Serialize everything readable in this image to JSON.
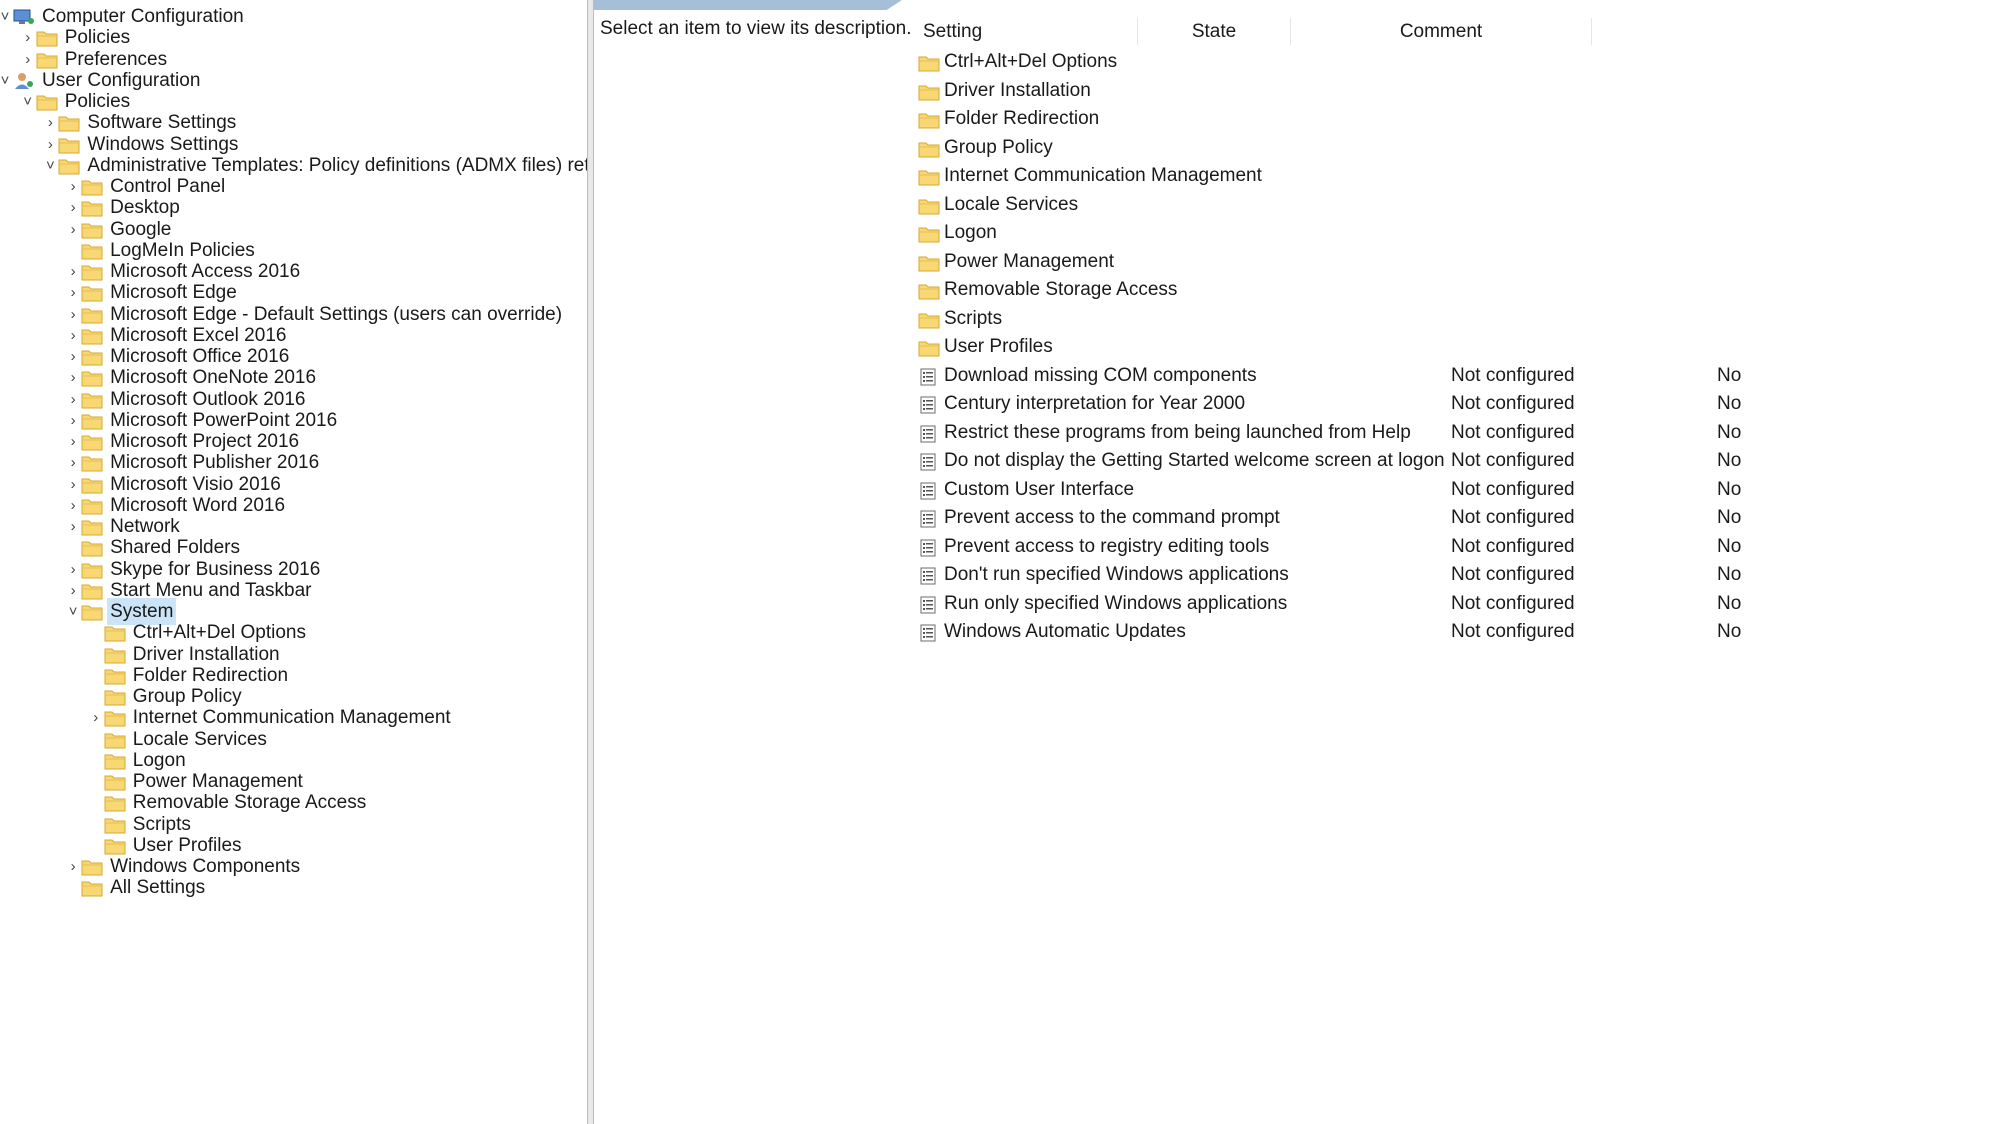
{
  "tree": [
    {
      "label": "Computer Configuration",
      "chev": "down",
      "icon": "computer-config-icon",
      "level": 0
    },
    {
      "label": "Policies",
      "chev": "right",
      "icon": "folder-icon",
      "level": 1
    },
    {
      "label": "Preferences",
      "chev": "right",
      "icon": "folder-icon",
      "level": 1
    },
    {
      "label": "User Configuration",
      "chev": "down",
      "icon": "user-config-icon",
      "level": 0
    },
    {
      "label": "Policies",
      "chev": "down",
      "icon": "folder-icon",
      "level": 1
    },
    {
      "label": "Software Settings",
      "chev": "right",
      "icon": "folder-icon",
      "level": 2
    },
    {
      "label": "Windows Settings",
      "chev": "right",
      "icon": "folder-icon",
      "level": 2
    },
    {
      "label": "Administrative Templates: Policy definitions (ADMX files) retrieved from the central store.",
      "chev": "down",
      "icon": "folder-icon",
      "level": 2
    },
    {
      "label": "Control Panel",
      "chev": "right",
      "icon": "folder-icon",
      "level": 3
    },
    {
      "label": "Desktop",
      "chev": "right",
      "icon": "folder-icon",
      "level": 3
    },
    {
      "label": "Google",
      "chev": "right",
      "icon": "folder-icon",
      "level": 3
    },
    {
      "label": "LogMeIn Policies",
      "chev": "none",
      "icon": "folder-icon",
      "level": 3
    },
    {
      "label": "Microsoft Access 2016",
      "chev": "right",
      "icon": "folder-icon",
      "level": 3
    },
    {
      "label": "Microsoft Edge",
      "chev": "right",
      "icon": "folder-icon",
      "level": 3
    },
    {
      "label": "Microsoft Edge - Default Settings (users can override)",
      "chev": "right",
      "icon": "folder-icon",
      "level": 3
    },
    {
      "label": "Microsoft Excel 2016",
      "chev": "right",
      "icon": "folder-icon",
      "level": 3
    },
    {
      "label": "Microsoft Office 2016",
      "chev": "right",
      "icon": "folder-icon",
      "level": 3
    },
    {
      "label": "Microsoft OneNote 2016",
      "chev": "right",
      "icon": "folder-icon",
      "level": 3
    },
    {
      "label": "Microsoft Outlook 2016",
      "chev": "right",
      "icon": "folder-icon",
      "level": 3
    },
    {
      "label": "Microsoft PowerPoint 2016",
      "chev": "right",
      "icon": "folder-icon",
      "level": 3
    },
    {
      "label": "Microsoft Project 2016",
      "chev": "right",
      "icon": "folder-icon",
      "level": 3
    },
    {
      "label": "Microsoft Publisher 2016",
      "chev": "right",
      "icon": "folder-icon",
      "level": 3
    },
    {
      "label": "Microsoft Visio 2016",
      "chev": "right",
      "icon": "folder-icon",
      "level": 3
    },
    {
      "label": "Microsoft Word 2016",
      "chev": "right",
      "icon": "folder-icon",
      "level": 3
    },
    {
      "label": "Network",
      "chev": "right",
      "icon": "folder-icon",
      "level": 3
    },
    {
      "label": "Shared Folders",
      "chev": "none",
      "icon": "folder-icon",
      "level": 3
    },
    {
      "label": "Skype for Business 2016",
      "chev": "right",
      "icon": "folder-icon",
      "level": 3
    },
    {
      "label": "Start Menu and Taskbar",
      "chev": "right",
      "icon": "folder-icon",
      "level": 3
    },
    {
      "label": "System",
      "chev": "down",
      "icon": "folder-icon",
      "level": 3,
      "selected": true
    },
    {
      "label": "Ctrl+Alt+Del Options",
      "chev": "none",
      "icon": "folder-icon",
      "level": 4
    },
    {
      "label": "Driver Installation",
      "chev": "none",
      "icon": "folder-icon",
      "level": 4
    },
    {
      "label": "Folder Redirection",
      "chev": "none",
      "icon": "folder-icon",
      "level": 4
    },
    {
      "label": "Group Policy",
      "chev": "none",
      "icon": "folder-icon",
      "level": 4
    },
    {
      "label": "Internet Communication Management",
      "chev": "right",
      "icon": "folder-icon",
      "level": 4
    },
    {
      "label": "Locale Services",
      "chev": "none",
      "icon": "folder-icon",
      "level": 4
    },
    {
      "label": "Logon",
      "chev": "none",
      "icon": "folder-icon",
      "level": 4
    },
    {
      "label": "Power Management",
      "chev": "none",
      "icon": "folder-icon",
      "level": 4
    },
    {
      "label": "Removable Storage Access",
      "chev": "none",
      "icon": "folder-icon",
      "level": 4
    },
    {
      "label": "Scripts",
      "chev": "none",
      "icon": "folder-icon",
      "level": 4
    },
    {
      "label": "User Profiles",
      "chev": "none",
      "icon": "folder-icon",
      "level": 4
    },
    {
      "label": "Windows Components",
      "chev": "right",
      "icon": "folder-icon",
      "level": 3
    },
    {
      "label": "All Settings",
      "chev": "none",
      "icon": "folder-icon",
      "level": 3
    }
  ],
  "description": "Select an item to view its description.",
  "columns": {
    "setting": "Setting",
    "state": "State",
    "comment": "Comment"
  },
  "settings": [
    {
      "name": "Ctrl+Alt+Del Options",
      "type": "folder",
      "state": "",
      "comment": ""
    },
    {
      "name": "Driver Installation",
      "type": "folder",
      "state": "",
      "comment": ""
    },
    {
      "name": "Folder Redirection",
      "type": "folder",
      "state": "",
      "comment": ""
    },
    {
      "name": "Group Policy",
      "type": "folder",
      "state": "",
      "comment": ""
    },
    {
      "name": "Internet Communication Management",
      "type": "folder",
      "state": "",
      "comment": ""
    },
    {
      "name": "Locale Services",
      "type": "folder",
      "state": "",
      "comment": ""
    },
    {
      "name": "Logon",
      "type": "folder",
      "state": "",
      "comment": ""
    },
    {
      "name": "Power Management",
      "type": "folder",
      "state": "",
      "comment": ""
    },
    {
      "name": "Removable Storage Access",
      "type": "folder",
      "state": "",
      "comment": ""
    },
    {
      "name": "Scripts",
      "type": "folder",
      "state": "",
      "comment": ""
    },
    {
      "name": "User Profiles",
      "type": "folder",
      "state": "",
      "comment": ""
    },
    {
      "name": "Download missing COM components",
      "type": "policy",
      "state": "Not configured",
      "comment": "No"
    },
    {
      "name": "Century interpretation for Year 2000",
      "type": "policy",
      "state": "Not configured",
      "comment": "No"
    },
    {
      "name": "Restrict these programs from being launched from Help",
      "type": "policy",
      "state": "Not configured",
      "comment": "No"
    },
    {
      "name": "Do not display the Getting Started welcome screen at logon",
      "type": "policy",
      "state": "Not configured",
      "comment": "No"
    },
    {
      "name": "Custom User Interface",
      "type": "policy",
      "state": "Not configured",
      "comment": "No"
    },
    {
      "name": "Prevent access to the command prompt",
      "type": "policy",
      "state": "Not configured",
      "comment": "No"
    },
    {
      "name": "Prevent access to registry editing tools",
      "type": "policy",
      "state": "Not configured",
      "comment": "No"
    },
    {
      "name": "Don't run specified Windows applications",
      "type": "policy",
      "state": "Not configured",
      "comment": "No"
    },
    {
      "name": "Run only specified Windows applications",
      "type": "policy",
      "state": "Not configured",
      "comment": "No"
    },
    {
      "name": "Windows Automatic Updates",
      "type": "policy",
      "state": "Not configured",
      "comment": "No"
    }
  ],
  "colors": {
    "folder": "#f8d775",
    "folder_edge": "#d9a82e",
    "selection": "#cce4f7",
    "tab": "#a6bfd8"
  }
}
